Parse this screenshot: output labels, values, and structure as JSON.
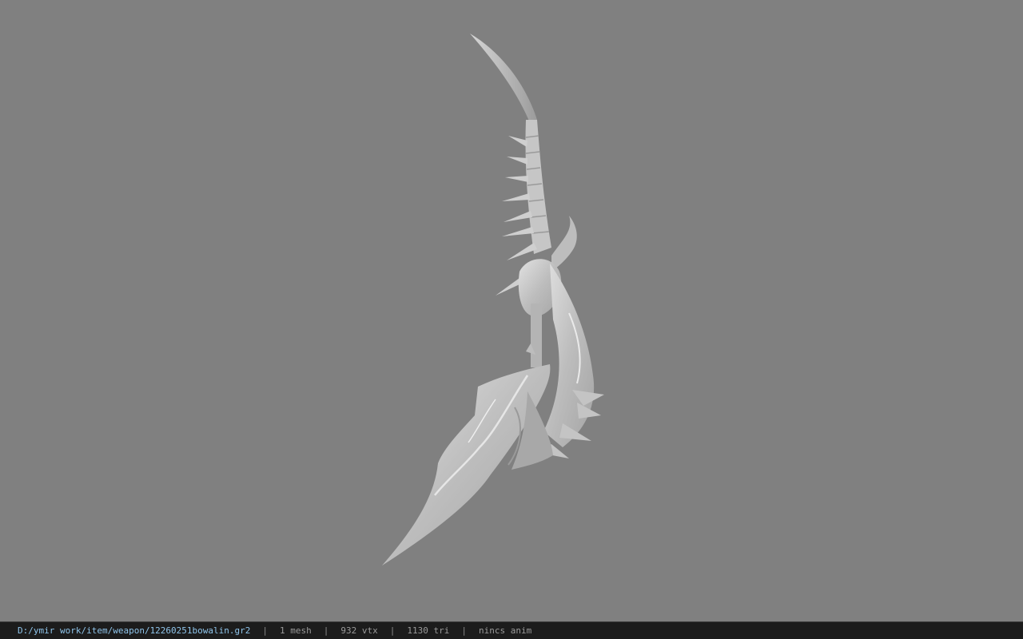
{
  "viewport": {
    "background_color": "#808080",
    "model_color": "#c9c9c9"
  },
  "statusbar": {
    "file_path": "D:/ymir work/item/weapon/12260251bowalin.gr2",
    "separator": "|",
    "mesh_count": "1 mesh",
    "vertex_count": "932 vtx",
    "triangle_count": "1130 tri",
    "animation": "nincs anim",
    "path_color": "#8fc4ea"
  }
}
